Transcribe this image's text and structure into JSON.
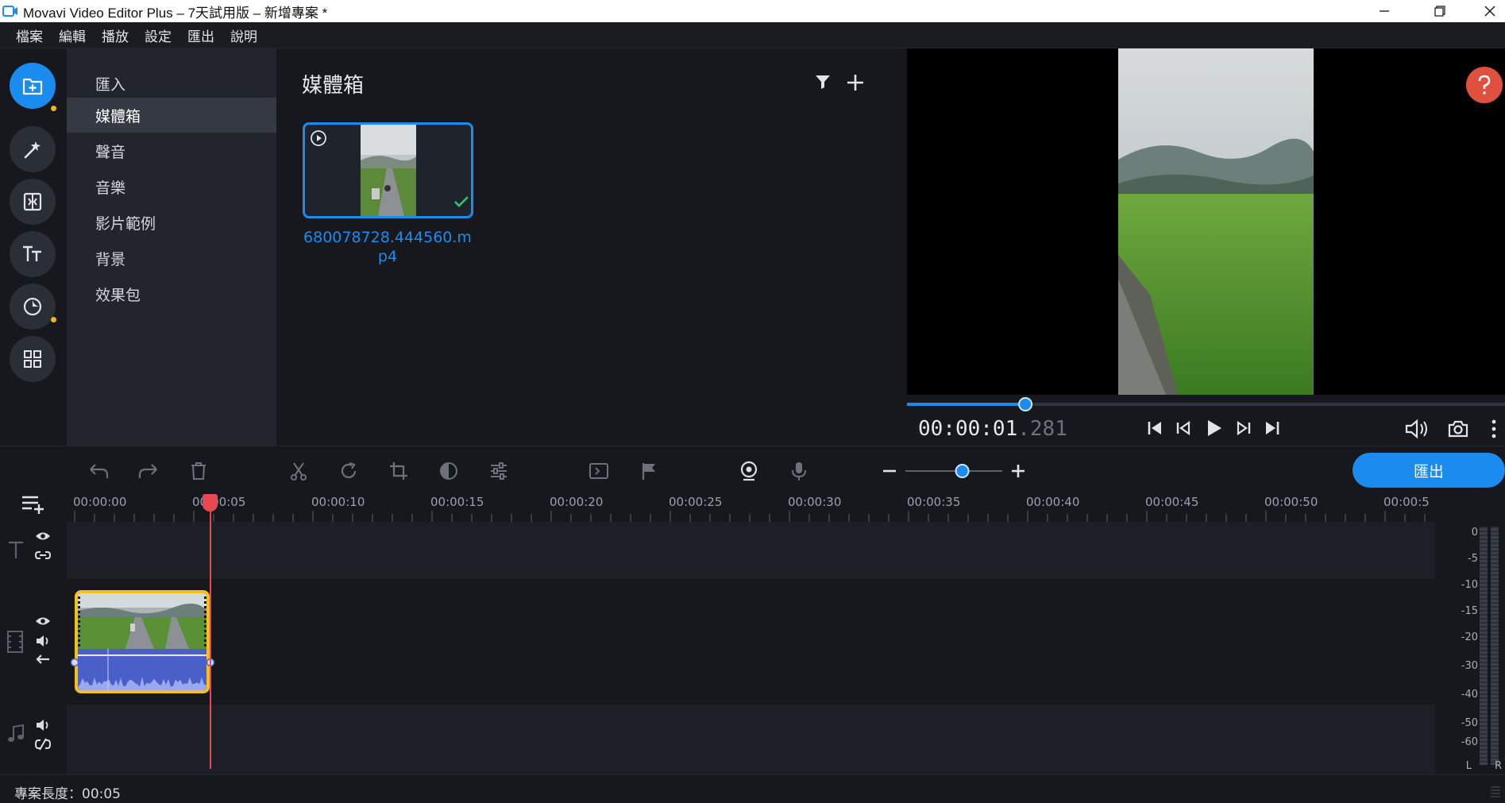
{
  "window": {
    "title": "Movavi Video Editor Plus – 7天試用版 – 新增專案 *"
  },
  "menu": [
    "檔案",
    "編輯",
    "播放",
    "設定",
    "匯出",
    "說明"
  ],
  "rail": [
    {
      "icon": "import-icon",
      "active": true
    },
    {
      "icon": "magic-wand-icon",
      "active": false,
      "dot": true
    },
    {
      "icon": "transitions-icon",
      "active": false
    },
    {
      "icon": "titles-icon",
      "active": false
    },
    {
      "icon": "stickers-icon",
      "active": false
    },
    {
      "icon": "more-tools-icon",
      "active": false,
      "dot": true
    }
  ],
  "categories": [
    {
      "label": "匯入"
    },
    {
      "label": "媒體箱",
      "active": true
    },
    {
      "label": "聲音"
    },
    {
      "label": "音樂"
    },
    {
      "label": "影片範例"
    },
    {
      "label": "背景"
    },
    {
      "label": "效果包"
    }
  ],
  "mediabin": {
    "title": "媒體箱",
    "clip": {
      "name": "680078728.444560.mp4"
    }
  },
  "player": {
    "timecode_main": "00:00:01",
    "timecode_ms": ".281",
    "progress": 0.198
  },
  "toolbar": {
    "export_label": "匯出",
    "zoom_level": 0.6
  },
  "timeline": {
    "ruler": [
      "00:00:00",
      "00:00:05",
      "00:00:10",
      "00:00:15",
      "00:00:20",
      "00:00:25",
      "00:00:30",
      "00:00:35",
      "00:00:40",
      "00:00:45",
      "00:00:50",
      "00:00:5"
    ]
  },
  "meter": {
    "labels": [
      "0",
      "-5",
      "-10",
      "-15",
      "-20",
      "-30",
      "-40",
      "-50",
      "-60"
    ],
    "channels": [
      "L",
      "R"
    ]
  },
  "status": {
    "project_length": "專案長度：00:05"
  },
  "colors": {
    "accent": "#1a8cf0",
    "playhead": "#e8484e",
    "clip_border": "#f2c21c",
    "audio_wave": "#4b5fc9"
  }
}
